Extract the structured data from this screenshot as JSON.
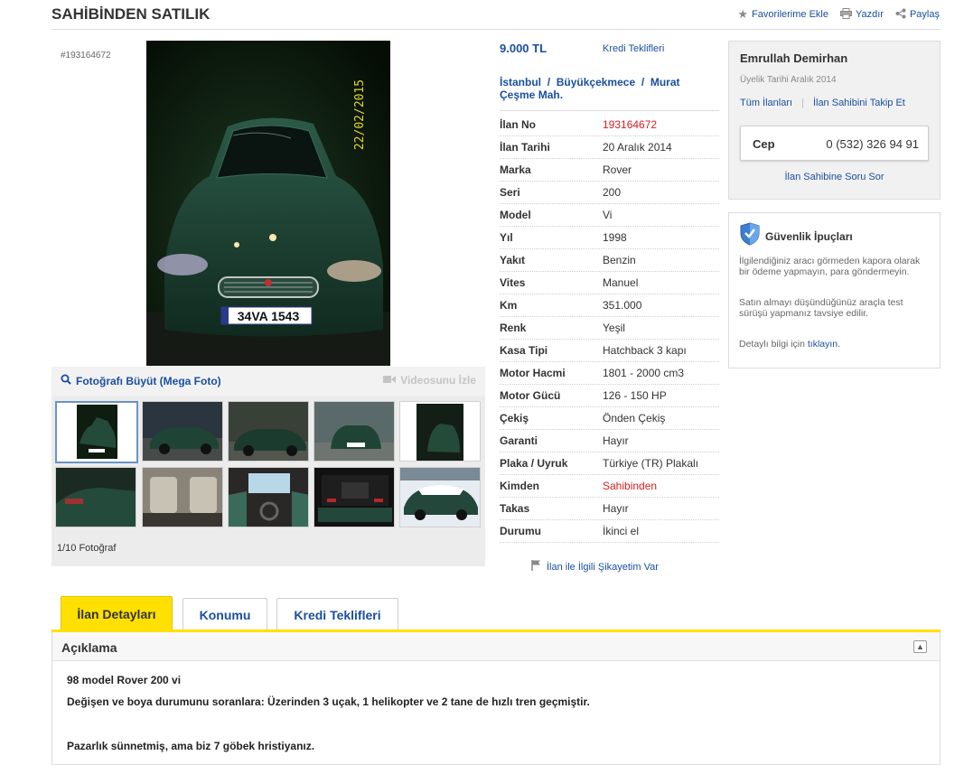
{
  "header": {
    "title": "SAHİBİNDEN SATILIK",
    "actions": [
      {
        "label": "Favorilerime Ekle",
        "icon": "star-icon"
      },
      {
        "label": "Yazdır",
        "icon": "printer-icon"
      },
      {
        "label": "Paylaş",
        "icon": "share-icon"
      }
    ]
  },
  "gallery": {
    "listing_id": "#193164672",
    "photo_date_stamp": "22/02/2015",
    "plate_text": "34VA 1543",
    "mega_foto_label": "Fotoğrafı Büyüt (Mega Foto)",
    "video_label": "Videosunu İzle",
    "photo_count": "1/10 Fotoğraf"
  },
  "listing": {
    "price": "9.000 TL",
    "credit_link": "Kredi Teklifleri",
    "location": {
      "city": "İstanbul",
      "district": "Büyükçekmece",
      "neighborhood": "Murat Çeşme Mah.",
      "separator": "/"
    },
    "specs": [
      {
        "label": "İlan No",
        "value": "193164672",
        "highlight": true
      },
      {
        "label": "İlan Tarihi",
        "value": "20 Aralık 2014"
      },
      {
        "label": "Marka",
        "value": "Rover"
      },
      {
        "label": "Seri",
        "value": "200"
      },
      {
        "label": "Model",
        "value": "Vi"
      },
      {
        "label": "Yıl",
        "value": "1998"
      },
      {
        "label": "Yakıt",
        "value": "Benzin"
      },
      {
        "label": "Vites",
        "value": "Manuel"
      },
      {
        "label": "Km",
        "value": "351.000"
      },
      {
        "label": "Renk",
        "value": "Yeşil"
      },
      {
        "label": "Kasa Tipi",
        "value": "Hatchback 3 kapı"
      },
      {
        "label": "Motor Hacmi",
        "value": "1801 - 2000 cm3"
      },
      {
        "label": "Motor Gücü",
        "value": "126 - 150 HP"
      },
      {
        "label": "Çekiş",
        "value": "Önden Çekiş"
      },
      {
        "label": "Garanti",
        "value": "Hayır"
      },
      {
        "label": "Plaka / Uyruk",
        "value": "Türkiye (TR) Plakalı"
      },
      {
        "label": "Kimden",
        "value": "Sahibinden",
        "highlight": true
      },
      {
        "label": "Takas",
        "value": "Hayır"
      },
      {
        "label": "Durumu",
        "value": "İkinci el"
      }
    ],
    "complaint_link": "İlan ile İlgili Şikayetim Var"
  },
  "seller": {
    "name": "Emrullah Demirhan",
    "member_since": "Üyelik Tarihi  Aralık 2014",
    "all_listings": "Tüm İlanları",
    "follow": "İlan Sahibini Takip Et",
    "phone_label": "Cep",
    "phone_number": "0 (532) 326 94 91",
    "ask_link": "İlan Sahibine Soru Sor"
  },
  "safety": {
    "title": "Güvenlik İpuçları",
    "tip1": "İlgilendiğiniz aracı görmeden kapora olarak bir ödeme yapmayın, para göndermeyin.",
    "tip2": "Satın almayı düşündüğünüz araçla test sürüşü yapmanız tavsiye edilir.",
    "tip3_prefix": "Detaylı bilgi için ",
    "tip3_link": "tıklayın."
  },
  "tabs": [
    {
      "label": "İlan Detayları",
      "active": true
    },
    {
      "label": "Konumu"
    },
    {
      "label": "Kredi Teklifleri"
    }
  ],
  "description": {
    "title": "Açıklama",
    "lines": [
      "98 model Rover 200 vi",
      "Değişen ve boya durumunu soranlara: Üzerinden 3 uçak, 1 helikopter ve 2 tane de hızlı tren geçmiştir.",
      "Pazarlık sünnetmiş, ama biz 7 göbek hristiyanız."
    ]
  },
  "colors": {
    "link_blue": "#1a4fa0",
    "accent_yellow": "#ffe000",
    "highlight_red": "#d81e1e",
    "car_green": "#1f3f2e"
  }
}
